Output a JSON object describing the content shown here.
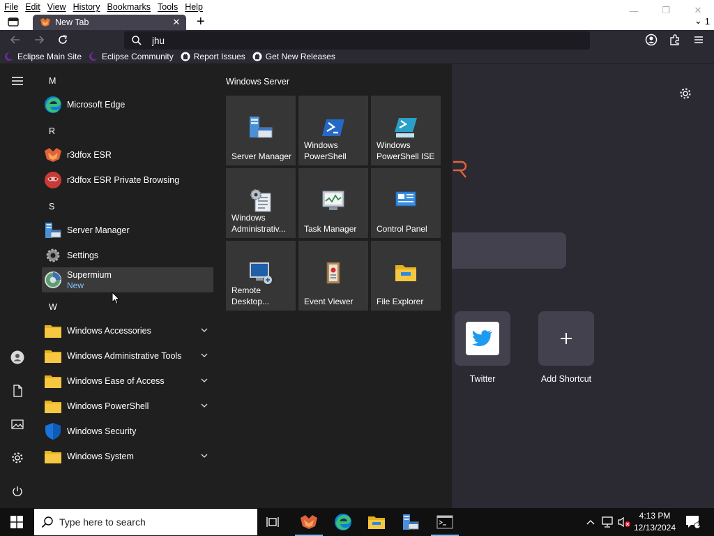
{
  "menubar": {
    "items": [
      "File",
      "Edit",
      "View",
      "History",
      "Bookmarks",
      "Tools",
      "Help"
    ]
  },
  "window_controls": {
    "minimize": "—",
    "restore": "❐",
    "close": "✕"
  },
  "tabs": {
    "active_title": "New Tab",
    "new_tab": "+",
    "list_count": "1"
  },
  "urlbar": {
    "value": "jhu",
    "placeholder": ""
  },
  "bookmarks": [
    {
      "label": "Eclipse Main Site",
      "icon": "eclipse-icon"
    },
    {
      "label": "Eclipse Community",
      "icon": "eclipse-icon"
    },
    {
      "label": "Report Issues",
      "icon": "github-icon"
    },
    {
      "label": "Get New Releases",
      "icon": "github-icon"
    }
  ],
  "start_menu": {
    "letters": {
      "m": "M",
      "r": "R",
      "s": "S",
      "w": "W"
    },
    "apps": {
      "edge": "Microsoft Edge",
      "r3dfox": "r3dfox ESR",
      "r3dfox_private": "r3dfox ESR Private Browsing",
      "server_manager": "Server Manager",
      "settings": "Settings",
      "supermium": "Supermium",
      "supermium_sub": "New",
      "accessories": "Windows Accessories",
      "admin_tools": "Windows Administrative Tools",
      "ease": "Windows Ease of Access",
      "powershell": "Windows PowerShell",
      "security": "Windows Security",
      "system": "Windows System"
    },
    "tiles_group": "Windows Server",
    "tiles": [
      {
        "label": "Server Manager",
        "icon": "server-manager-icon"
      },
      {
        "label": "Windows PowerShell",
        "icon": "powershell-icon"
      },
      {
        "label": "Windows PowerShell ISE",
        "icon": "powershell-ise-icon"
      },
      {
        "label": "Windows Administrativ...",
        "icon": "admin-tools-icon"
      },
      {
        "label": "Task Manager",
        "icon": "task-manager-icon"
      },
      {
        "label": "Control Panel",
        "icon": "control-panel-icon"
      },
      {
        "label": "Remote Desktop...",
        "icon": "remote-desktop-icon"
      },
      {
        "label": "Event Viewer",
        "icon": "event-viewer-icon"
      },
      {
        "label": "File Explorer",
        "icon": "file-explorer-icon"
      }
    ]
  },
  "newtab": {
    "shortcuts": [
      {
        "label": "Twitter",
        "icon": "twitter-icon"
      },
      {
        "label": "Add Shortcut",
        "icon": "plus-icon"
      }
    ]
  },
  "taskbar": {
    "search_placeholder": "Type here to search",
    "time": "4:13 PM",
    "date": "12/13/2024",
    "notification_count": "1"
  },
  "colors": {
    "accent": "#76b9ed",
    "tile_bg": "#363636",
    "menu_bg": "#1f1f1f",
    "browser_bg": "#2b2a33"
  }
}
